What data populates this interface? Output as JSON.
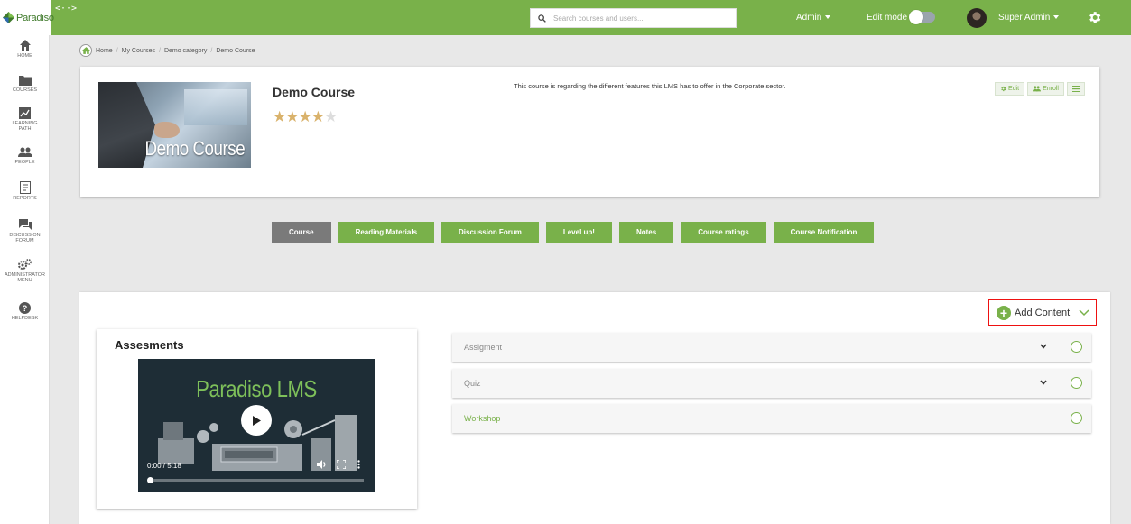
{
  "app": {
    "logo_text": "Paradiso",
    "collapse_toggle": "<··>"
  },
  "topbar": {
    "search_placeholder": "Search courses and users...",
    "admin_label": "Admin",
    "edit_mode_label": "Edit mode",
    "user_label": "Super Admin"
  },
  "sidebar": {
    "items": [
      {
        "label": "HOME",
        "icon": "home-icon"
      },
      {
        "label": "COURSES",
        "icon": "folder-icon"
      },
      {
        "label": "LEARNING PATH",
        "icon": "chart-icon"
      },
      {
        "label": "PEOPLE",
        "icon": "people-icon"
      },
      {
        "label": "REPORTS",
        "icon": "report-icon"
      },
      {
        "label": "DISCUSSION FORUM",
        "icon": "chat-icon"
      },
      {
        "label": "ADMINISTRATOR MENU",
        "icon": "gears-icon"
      },
      {
        "label": "HELPDESK",
        "icon": "help-icon"
      }
    ]
  },
  "breadcrumb": {
    "items": [
      "Home",
      "My Courses",
      "Demo category",
      "Demo Course"
    ]
  },
  "course": {
    "image_title": "Demo Course",
    "title": "Demo Course",
    "rating": 4,
    "rating_max": 5,
    "description": "This course is regarding the different features this LMS has to offer in the Corporate sector.",
    "actions": {
      "edit": "Edit",
      "enroll": "Enroll"
    }
  },
  "tabs": [
    {
      "label": "Course",
      "active": true
    },
    {
      "label": "Reading Materials",
      "active": false
    },
    {
      "label": "Discussion Forum",
      "active": false
    },
    {
      "label": "Level up!",
      "active": false
    },
    {
      "label": "Notes",
      "active": false
    },
    {
      "label": "Course ratings",
      "active": false
    },
    {
      "label": "Course Notification",
      "active": false
    }
  ],
  "content": {
    "add_content_label": "Add Content",
    "assessments": {
      "title": "Assesments",
      "video_brand": "Paradiso LMS",
      "video_time": "0:00 / 5:18",
      "progress": 0
    },
    "sections": [
      {
        "label": "Assigment",
        "expandable": true
      },
      {
        "label": "Quiz",
        "expandable": true
      },
      {
        "label": "Workshop",
        "expandable": false
      }
    ]
  },
  "colors": {
    "brand_green": "#79b14a",
    "active_tab": "#7a7a7a",
    "highlight_red": "#e11111"
  }
}
